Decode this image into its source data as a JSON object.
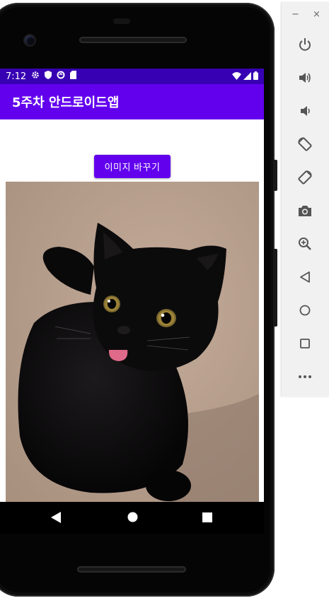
{
  "status_bar": {
    "time": "7:12"
  },
  "app_bar": {
    "title": "5주차 안드로이드앱"
  },
  "main": {
    "button_label": "이미지 바꾸기"
  },
  "emulator_panel": {
    "minimize": "−",
    "close": "×",
    "tools": [
      "power-icon",
      "volume-up-icon",
      "volume-down-icon",
      "rotate-left-icon",
      "rotate-right-icon",
      "camera-icon",
      "zoom-icon",
      "back-icon",
      "home-icon",
      "overview-icon",
      "more-icon"
    ]
  },
  "colors": {
    "primary": "#6200ee",
    "primary_dark": "#3700b3"
  }
}
